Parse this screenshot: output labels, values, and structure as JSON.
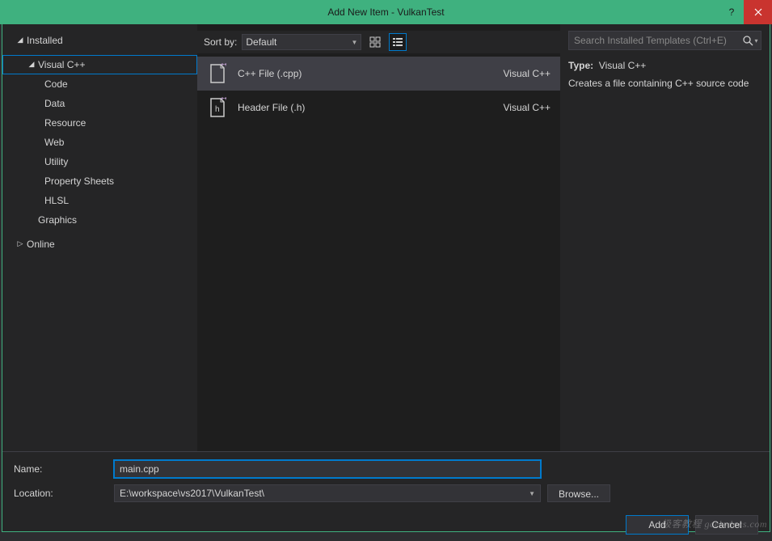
{
  "titlebar": {
    "title": "Add New Item - VulkanTest"
  },
  "sidebar": {
    "installed": "Installed",
    "visualcpp": "Visual C++",
    "items": [
      "Code",
      "Data",
      "Resource",
      "Web",
      "Utility",
      "Property Sheets",
      "HLSL"
    ],
    "graphics": "Graphics",
    "online": "Online"
  },
  "sortbar": {
    "label": "Sort by:",
    "value": "Default"
  },
  "templates": [
    {
      "name": "C++ File (.cpp)",
      "type": "Visual C++",
      "glyph": "++"
    },
    {
      "name": "Header File (.h)",
      "type": "Visual C++",
      "glyph": "h"
    }
  ],
  "search": {
    "placeholder": "Search Installed Templates (Ctrl+E)"
  },
  "detail": {
    "type_label": "Type:",
    "type_value": "Visual C++",
    "description": "Creates a file containing C++ source code"
  },
  "form": {
    "name_label": "Name:",
    "name_value": "main.cpp",
    "location_label": "Location:",
    "location_value": "E:\\workspace\\vs2017\\VulkanTest\\",
    "browse": "Browse..."
  },
  "buttons": {
    "add": "Add",
    "cancel": "Cancel"
  },
  "watermark": "极客教程 geek-docs.com"
}
